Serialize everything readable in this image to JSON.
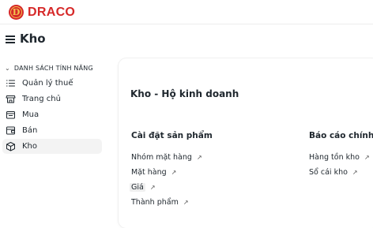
{
  "brand": {
    "logo_letter": "D",
    "name": "DRACO",
    "color": "#d62828"
  },
  "header": {
    "menu_icon": "hamburger-icon",
    "title": "Kho"
  },
  "sidebar": {
    "section_label": "DANH SÁCH TÍNH NĂNG",
    "items": [
      {
        "label": "Quản lý thuế",
        "icon": "list-icon"
      },
      {
        "label": "Trang chủ",
        "icon": "store-icon"
      },
      {
        "label": "Mua",
        "icon": "cart-icon"
      },
      {
        "label": "Bán",
        "icon": "wallet-icon"
      },
      {
        "label": "Kho",
        "icon": "box-icon",
        "active": true
      }
    ]
  },
  "main": {
    "card_title": "Kho - Hộ kinh doanh",
    "columns": [
      {
        "heading": "Cài đặt sản phẩm",
        "links": [
          "Nhóm mặt hàng",
          "Mặt hàng",
          "Giá",
          "Thành phẩm"
        ]
      },
      {
        "heading": "Báo cáo chính",
        "links": [
          "Hàng tồn kho",
          "Sổ cái kho"
        ]
      }
    ],
    "link_arrow": "↗"
  }
}
